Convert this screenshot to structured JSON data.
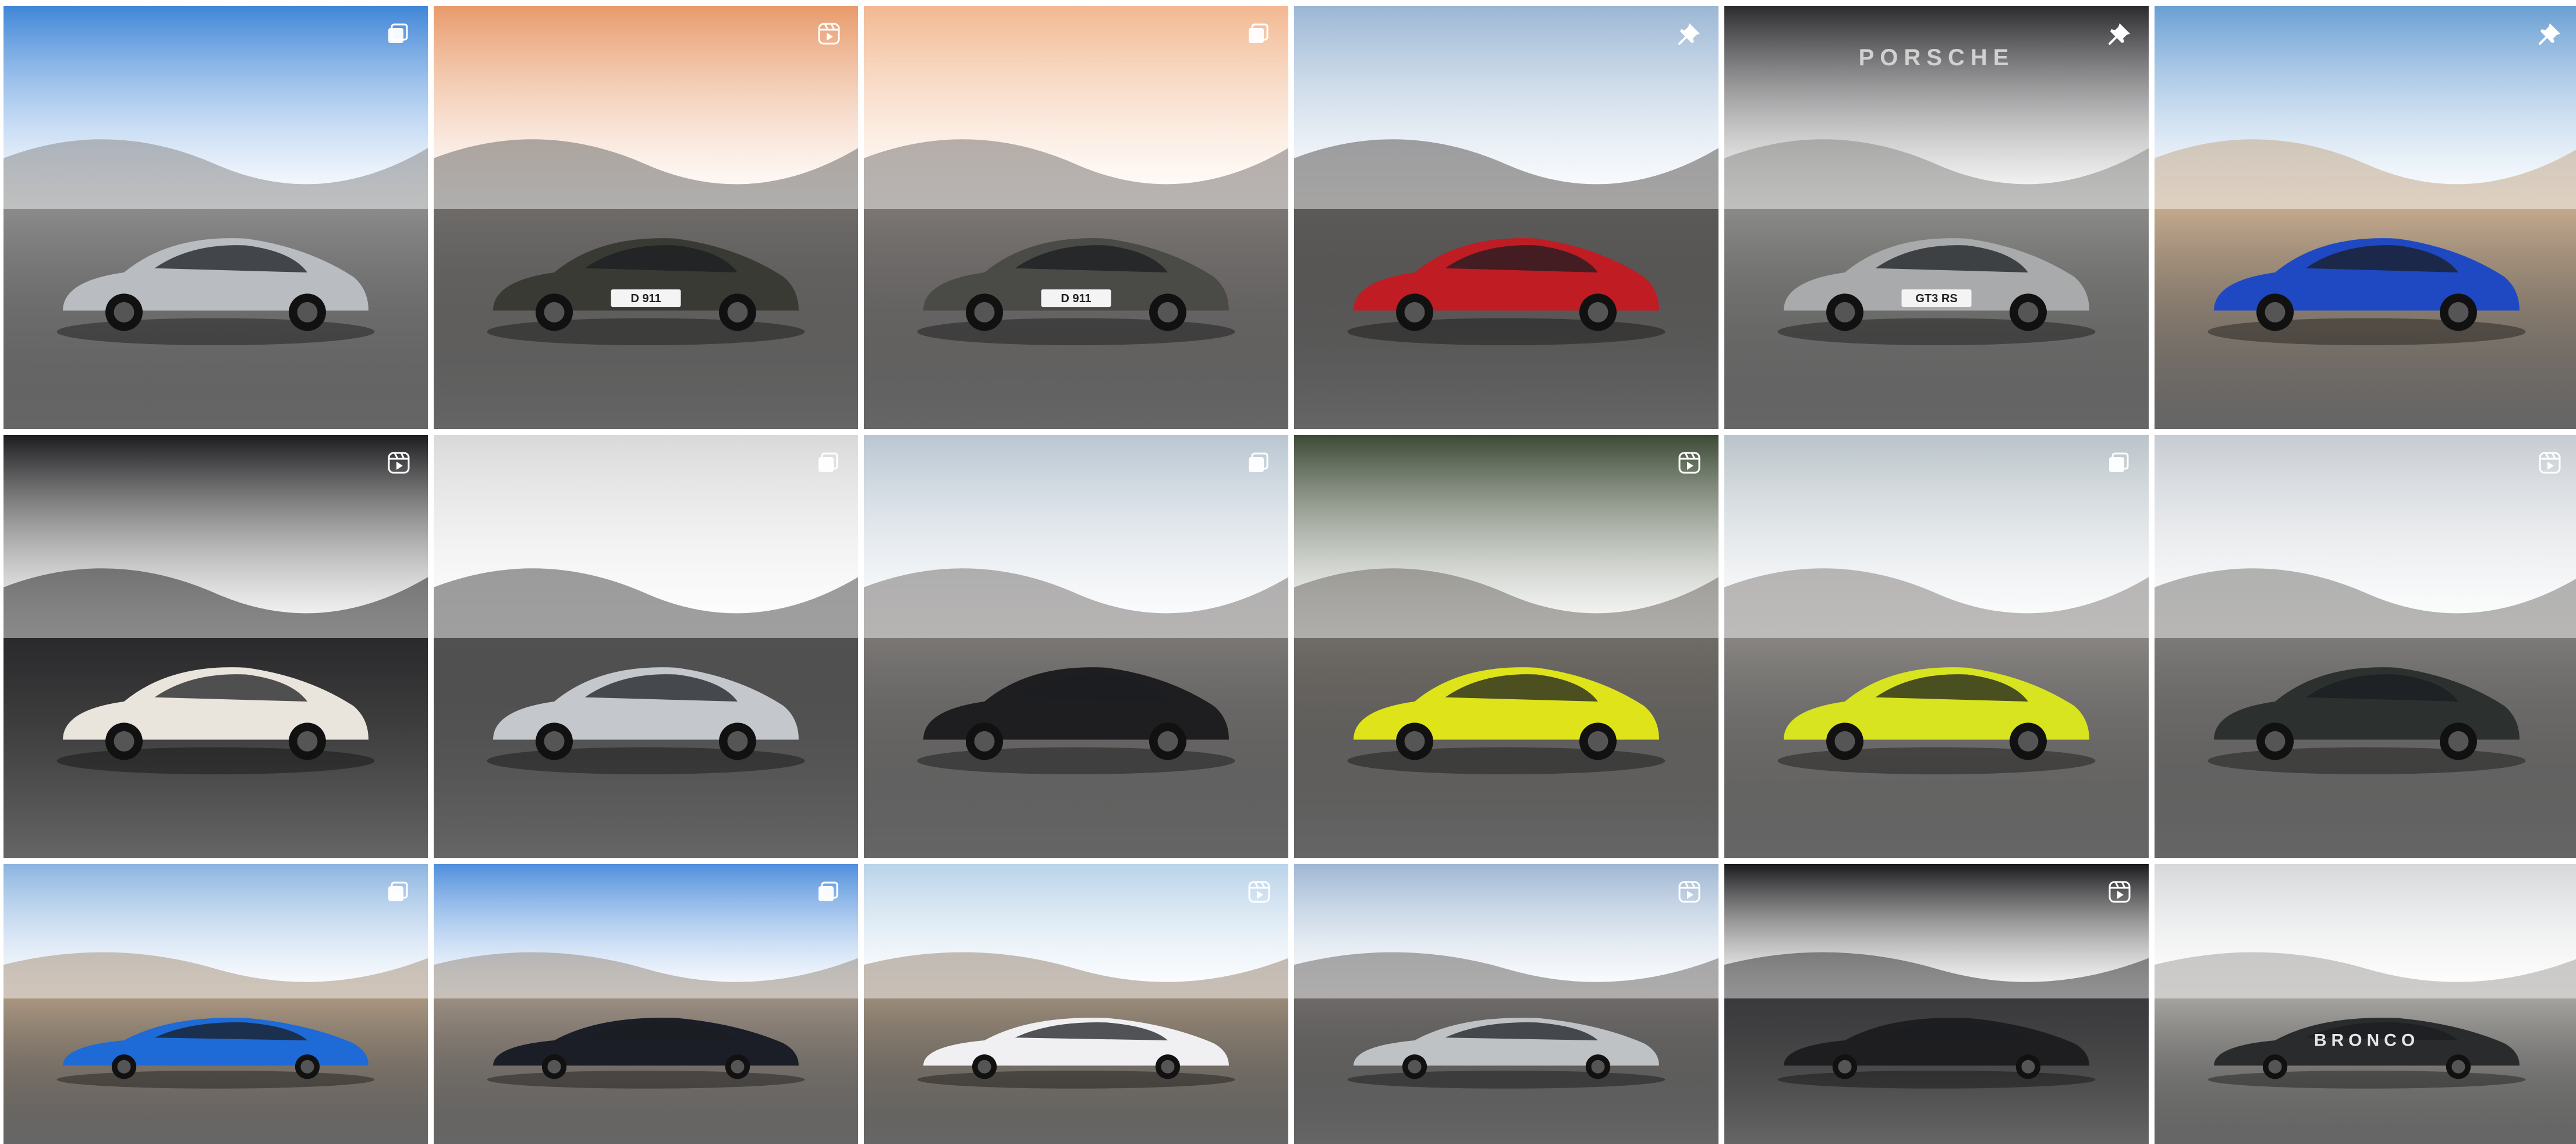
{
  "grid": {
    "columns": 6,
    "posts": [
      {
        "id": 1,
        "subject": "silver-lamborghini-aventador",
        "sky": "#3f86d8",
        "ground": "#8b8b8b",
        "car_color": "#b9bdc2",
        "badge": "carousel-icon"
      },
      {
        "id": 2,
        "subject": "dark-porsche-911-sunset",
        "sky": "#e89a6a",
        "ground": "#6e6b69",
        "car_color": "#3a3a35",
        "badge": "reel-icon",
        "plate": "D 911"
      },
      {
        "id": 3,
        "subject": "porsche-911-turbo-road",
        "sky": "#f2b890",
        "ground": "#7b7674",
        "car_color": "#4a4a46",
        "badge": "carousel-icon",
        "plate": "D 911"
      },
      {
        "id": 4,
        "subject": "red-ferrari-mountain",
        "sky": "#9bb6d4",
        "ground": "#5c5a58",
        "car_color": "#c01c24",
        "badge": "pin-icon"
      },
      {
        "id": 5,
        "subject": "porsche-gt3-rs-rear",
        "sky": "#2b2b2e",
        "ground": "#8a8a88",
        "car_color": "#a8aaab",
        "badge": "pin-icon",
        "plate": "GT3 RS",
        "wing_text": "PORSCHE"
      },
      {
        "id": 6,
        "subject": "jet-and-supercars",
        "sky": "#6a9fd4",
        "ground": "#c3a98c",
        "car_color": "#1f49c2",
        "badge": "pin-icon"
      },
      {
        "id": 7,
        "subject": "classic-porsche-356-showroom",
        "sky": "#1c1c1e",
        "ground": "#2a2a2c",
        "car_color": "#e9e4dc",
        "badge": "reel-icon"
      },
      {
        "id": 8,
        "subject": "silver-huracan-building",
        "sky": "#d9d9d9",
        "ground": "#515151",
        "car_color": "#c4c7cb",
        "badge": "carousel-icon"
      },
      {
        "id": 9,
        "subject": "black-porsche-gt2-rs",
        "sky": "#b9c6d2",
        "ground": "#7a7775",
        "car_color": "#1e1e20",
        "badge": "carousel-icon"
      },
      {
        "id": 10,
        "subject": "yellow-aventador-forest",
        "sky": "#3c4a34",
        "ground": "#6f6b66",
        "car_color": "#dfe31a",
        "badge": "reel-icon"
      },
      {
        "id": 11,
        "subject": "lime-aventador-mountain",
        "sky": "#b9c3c9",
        "ground": "#878481",
        "car_color": "#d8e41f",
        "badge": "carousel-icon"
      },
      {
        "id": 12,
        "subject": "bmw-m5-snow-mountain",
        "sky": "#c7ccd2",
        "ground": "#7c7a78",
        "car_color": "#2c3130",
        "badge": "reel-icon"
      },
      {
        "id": 13,
        "subject": "blue-lamborghini-jet",
        "sky": "#8bb4e0",
        "ground": "#a99680",
        "car_color": "#1e6ad6",
        "badge": "carousel-icon"
      },
      {
        "id": 14,
        "subject": "porsche-and-jet-photoshoot",
        "sky": "#4f8fdc",
        "ground": "#9b8e82",
        "car_color": "#1b1e26",
        "badge": "carousel-icon"
      },
      {
        "id": 15,
        "subject": "white-lamborghini-doors-up",
        "sky": "#b9d3e9",
        "ground": "#9a8b79",
        "car_color": "#f0f0f2",
        "badge": "reel-icon"
      },
      {
        "id": 16,
        "subject": "silver-porsche-gt3-coast",
        "sky": "#9fb7d3",
        "ground": "#6d6a68",
        "car_color": "#bfc2c5",
        "badge": "reel-icon"
      },
      {
        "id": 17,
        "subject": "black-cars-showroom",
        "sky": "#1a1a1c",
        "ground": "#3a3a3c",
        "car_color": "#1e1e20",
        "badge": "reel-icon"
      },
      {
        "id": 18,
        "subject": "ford-bronco-snow",
        "sky": "#d6d8da",
        "ground": "#a4a39f",
        "car_color": "#2a2b2c",
        "badge": "",
        "grille_text": "BRONCO"
      }
    ]
  }
}
